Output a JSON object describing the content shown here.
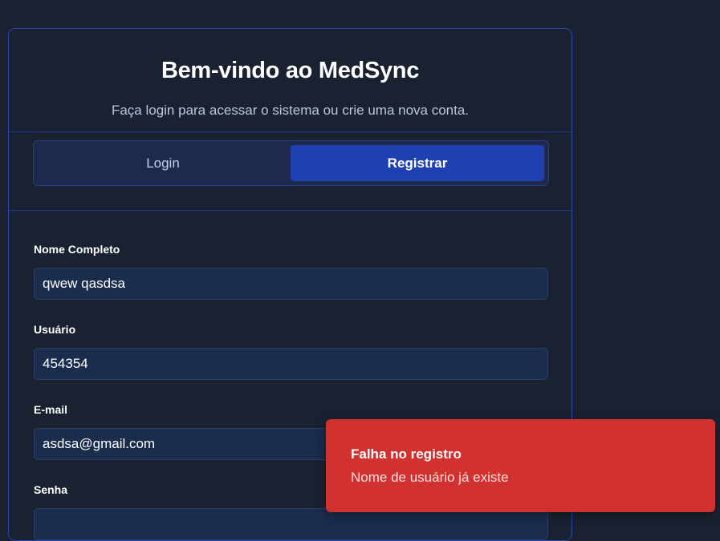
{
  "header": {
    "title": "Bem-vindo ao MedSync",
    "subtitle": "Faça login para acessar o sistema ou crie uma nova conta."
  },
  "tabs": {
    "login": "Login",
    "register": "Registrar",
    "active": "register"
  },
  "form": {
    "full_name": {
      "label": "Nome Completo",
      "value": "qwew qasdsa"
    },
    "username": {
      "label": "Usuário",
      "value": "454354"
    },
    "email": {
      "label": "E-mail",
      "value": "asdsa@gmail.com"
    },
    "password": {
      "label": "Senha",
      "value": ""
    }
  },
  "toast": {
    "title": "Falha no registro",
    "message": "Nome de usuário já existe",
    "color": "#d13230"
  },
  "colors": {
    "background": "#1a2231",
    "accent": "#1f40b0",
    "border": "#2a46a8"
  }
}
